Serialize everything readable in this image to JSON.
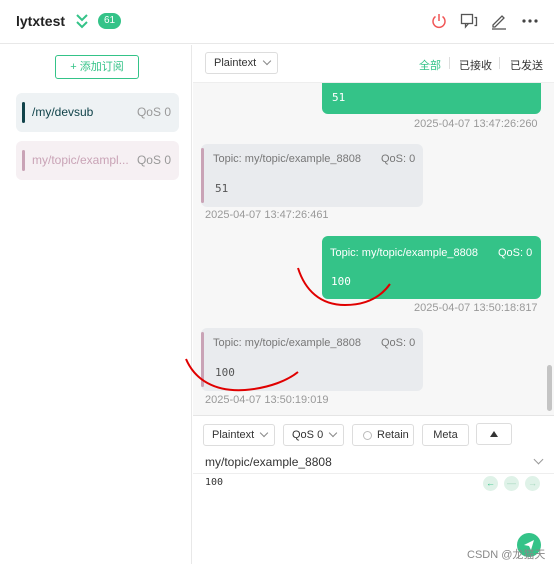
{
  "header": {
    "connection_name": "lytxtest",
    "count_badge": "61",
    "icons": [
      "chevrons-down-icon",
      "power-icon",
      "chat-icon",
      "edit-icon",
      "more-icon"
    ]
  },
  "sidebar": {
    "add_subscription_label": "添加订阅",
    "subscriptions": [
      {
        "topic": "/my/devsub",
        "qos": "QoS 0",
        "color": "#11434a"
      },
      {
        "topic": "my/topic/exampl...",
        "qos": "QoS 0",
        "color": "#c9a3b6"
      }
    ]
  },
  "toolbar": {
    "format": "Plaintext",
    "filters": [
      "全部",
      "已接收",
      "已发送"
    ]
  },
  "messages": [
    {
      "direction": "out",
      "payload": "51",
      "time": "2025-04-07 13:47:26:260"
    },
    {
      "direction": "in",
      "topic": "Topic: my/topic/example_8808",
      "qos": "QoS: 0",
      "payload": "51",
      "time": "2025-04-07 13:47:26:461"
    },
    {
      "direction": "out",
      "topic": "Topic: my/topic/example_8808",
      "qos": "QoS: 0",
      "payload": "100",
      "time": "2025-04-07 13:50:18:817"
    },
    {
      "direction": "in",
      "topic": "Topic: my/topic/example_8808",
      "qos": "QoS: 0",
      "payload": "100",
      "time": "2025-04-07 13:50:19:019"
    }
  ],
  "publish": {
    "format": "Plaintext",
    "qos": "QoS 0",
    "retain_label": "Retain",
    "meta_label": "Meta",
    "topic": "my/topic/example_8808",
    "payload": "100"
  },
  "colors": {
    "accent": "#34c388",
    "subscription_dark": "#11434a",
    "subscription_pink": "#c9a3b6",
    "annotation": "#e00000"
  },
  "watermark": "CSDN @龙猫天下"
}
